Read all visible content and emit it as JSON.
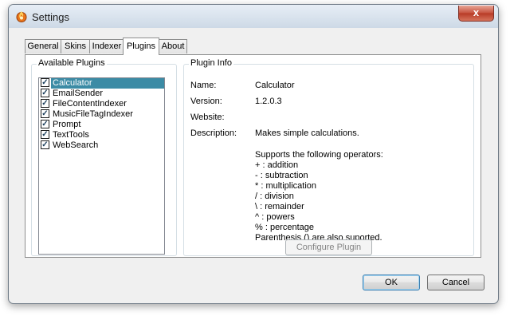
{
  "window": {
    "title": "Settings",
    "close_glyph": "x",
    "icon": "app-flame-icon"
  },
  "tabs": [
    {
      "label": "General",
      "active": false
    },
    {
      "label": "Skins",
      "active": false
    },
    {
      "label": "Indexer",
      "active": false
    },
    {
      "label": "Plugins",
      "active": true
    },
    {
      "label": "About",
      "active": false
    }
  ],
  "available_plugins": {
    "title": "Available Plugins",
    "items": [
      {
        "label": "Calculator",
        "checked": true,
        "selected": true
      },
      {
        "label": "EmailSender",
        "checked": true,
        "selected": false
      },
      {
        "label": "FileContentIndexer",
        "checked": true,
        "selected": false
      },
      {
        "label": "MusicFileTagIndexer",
        "checked": true,
        "selected": false
      },
      {
        "label": "Prompt",
        "checked": true,
        "selected": false
      },
      {
        "label": "TextTools",
        "checked": true,
        "selected": false
      },
      {
        "label": "WebSearch",
        "checked": true,
        "selected": false
      }
    ]
  },
  "plugin_info": {
    "title": "Plugin Info",
    "name_label": "Name:",
    "name_value": "Calculator",
    "version_label": "Version:",
    "version_value": "1.2.0.3",
    "website_label": "Website:",
    "website_value": "",
    "description_label": "Description:",
    "description_value": "Makes simple calculations.",
    "operators_intro": "Supports the following operators:",
    "operators": [
      "+ : addition",
      "- : subtraction",
      "* : multiplication",
      "/ : division",
      "\\ : remainder",
      "^ : powers",
      "% : percentage",
      "Parenthesis () are also suported."
    ],
    "configure_button": "Configure Plugin"
  },
  "buttons": {
    "ok": "OK",
    "cancel": "Cancel"
  },
  "colors": {
    "selection": "#3b8ba5",
    "close_button": "#c6513d"
  }
}
